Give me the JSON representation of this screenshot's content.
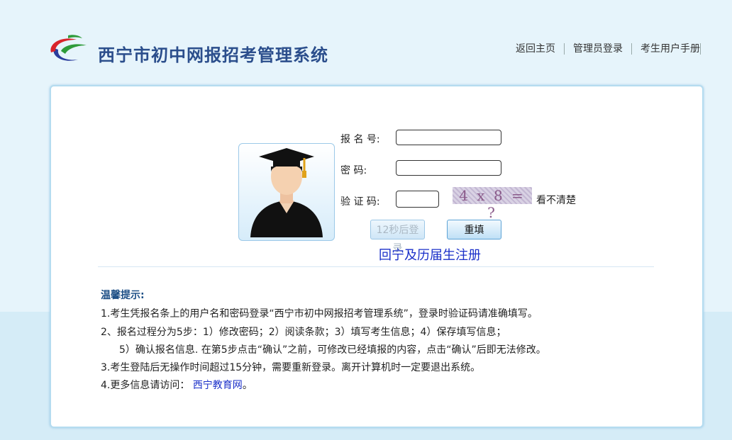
{
  "header": {
    "title": "西宁市初中网报招考管理系统",
    "nav": [
      "返回主页",
      "管理员登录",
      "考生用户手册"
    ]
  },
  "form": {
    "id_label": "报 名  号:",
    "password_label": "密      码:",
    "captcha_label": "验 证  码:",
    "id_value": "",
    "password_value": "",
    "captcha_value": "",
    "captcha_text": "4 x 8 = ?",
    "refresh_label": "看不清楚",
    "login_button": "12秒后登录",
    "reset_button": "重填",
    "register_link": "回宁及历届生注册"
  },
  "tips": {
    "title": "温馨提示:",
    "line1": "1.考生凭报名条上的用户名和密码登录“西宁市初中网报招考管理系统”，登录时验证码请准确填写。",
    "line2": "2、报名过程分为5步：1）修改密码；2）阅读条款；3）填写考生信息；4）保存填写信息；",
    "line3": "5）确认报名信息. 在第5步点击“确认”之前，可修改已经填报的内容，点击“确认”后即无法修改。",
    "line4": "3.考生登陆后无操作时间超过15分钟，需要重新登录。离开计算机时一定要退出系统。",
    "line5_prefix": "4.更多信息请访问：",
    "line5_link": "西宁教育网",
    "line5_suffix": "。"
  },
  "colors": {
    "title": "#2b4e8c",
    "link": "#1a2fc9",
    "panel_border": "#b5dcf0"
  }
}
